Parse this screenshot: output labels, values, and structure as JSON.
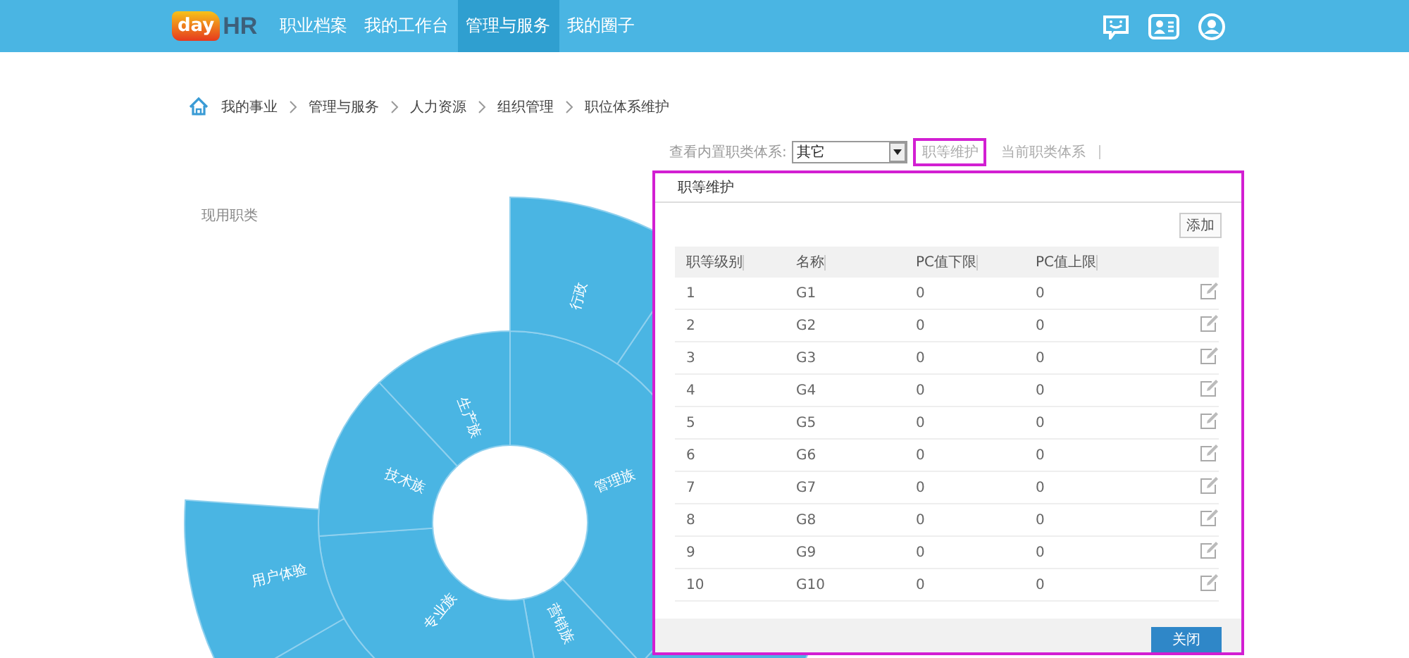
{
  "top_nav": {
    "logo": {
      "day": "day",
      "hr": "HR"
    },
    "items": [
      {
        "label": "职业档案",
        "selected": false
      },
      {
        "label": "我的工作台",
        "selected": false
      },
      {
        "label": "管理与服务",
        "selected": true
      },
      {
        "label": "我的圈子",
        "selected": false
      }
    ]
  },
  "breadcrumb": [
    "我的事业",
    "管理与服务",
    "人力资源",
    "组织管理",
    "职位体系维护"
  ],
  "filter": {
    "label": "查看内置职类体系:",
    "value": "其它"
  },
  "tabs": [
    {
      "label": "职等维护",
      "highlighted": true
    },
    {
      "label": "当前职类体系",
      "highlighted": false
    }
  ],
  "chart": {
    "title": "现用职类",
    "segments": [
      {
        "label": "管理族"
      },
      {
        "label": "营销族"
      },
      {
        "label": "专业族"
      },
      {
        "label": "技术族"
      },
      {
        "label": "生产族"
      },
      {
        "label": "行政"
      },
      {
        "label": "用户体验"
      }
    ]
  },
  "dialog": {
    "title": "职等维护",
    "highlighted": true,
    "add_button": "添加",
    "columns": [
      "职等级别",
      "名称",
      "PC值下限",
      "PC值上限"
    ],
    "rows": [
      [
        "1",
        "G1",
        "0",
        "0"
      ],
      [
        "2",
        "G2",
        "0",
        "0"
      ],
      [
        "3",
        "G3",
        "0",
        "0"
      ],
      [
        "4",
        "G4",
        "0",
        "0"
      ],
      [
        "5",
        "G5",
        "0",
        "0"
      ],
      [
        "6",
        "G6",
        "0",
        "0"
      ],
      [
        "7",
        "G7",
        "0",
        "0"
      ],
      [
        "8",
        "G8",
        "0",
        "0"
      ],
      [
        "9",
        "G9",
        "0",
        "0"
      ],
      [
        "10",
        "G10",
        "0",
        "0"
      ]
    ],
    "close_button": "关闭"
  }
}
